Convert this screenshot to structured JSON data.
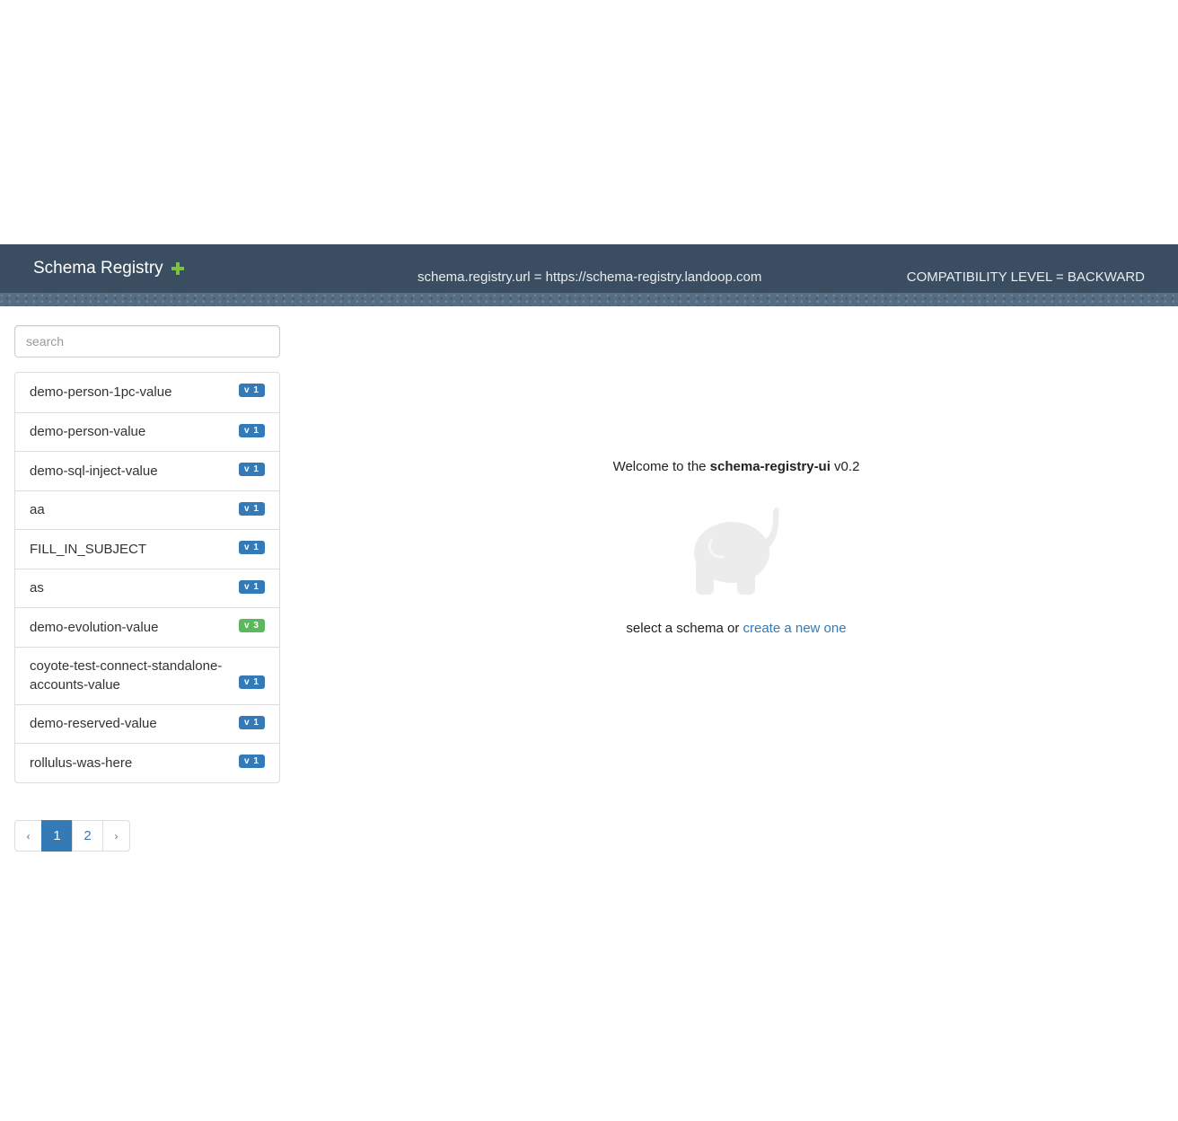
{
  "header": {
    "brand": "Schema Registry",
    "registry_url": "schema.registry.url = https://schema-registry.landoop.com",
    "compatibility": "COMPATIBILITY LEVEL = BACKWARD",
    "add_icon": "plus-icon",
    "accent_color": "#7cc242",
    "bar_color": "#3b4e61"
  },
  "sidebar": {
    "search_placeholder": "search",
    "subjects": [
      {
        "name": "demo-person-1pc-value",
        "version": "v 1"
      },
      {
        "name": "demo-person-value",
        "version": "v 1"
      },
      {
        "name": "demo-sql-inject-value",
        "version": "v 1"
      },
      {
        "name": "aa",
        "version": "v 1"
      },
      {
        "name": "FILL_IN_SUBJECT",
        "version": "v 1"
      },
      {
        "name": "as",
        "version": "v 1"
      },
      {
        "name": "demo-evolution-value",
        "version": "v 3"
      },
      {
        "name": "coyote-test-connect-standalone-accounts-value",
        "version": "v 1"
      },
      {
        "name": "demo-reserved-value",
        "version": "v 1"
      },
      {
        "name": "rollulus-was-here",
        "version": "v 1"
      }
    ]
  },
  "pagination": {
    "prev": "‹",
    "pages": [
      "1",
      "2"
    ],
    "current": "1",
    "next": "›"
  },
  "main": {
    "welcome_prefix": "Welcome to the ",
    "welcome_app": "schema-registry-ui",
    "welcome_version": " v0.2",
    "select_prefix": "select a schema or ",
    "create_link": "create a new one",
    "logo_icon": "elephant-icon"
  }
}
